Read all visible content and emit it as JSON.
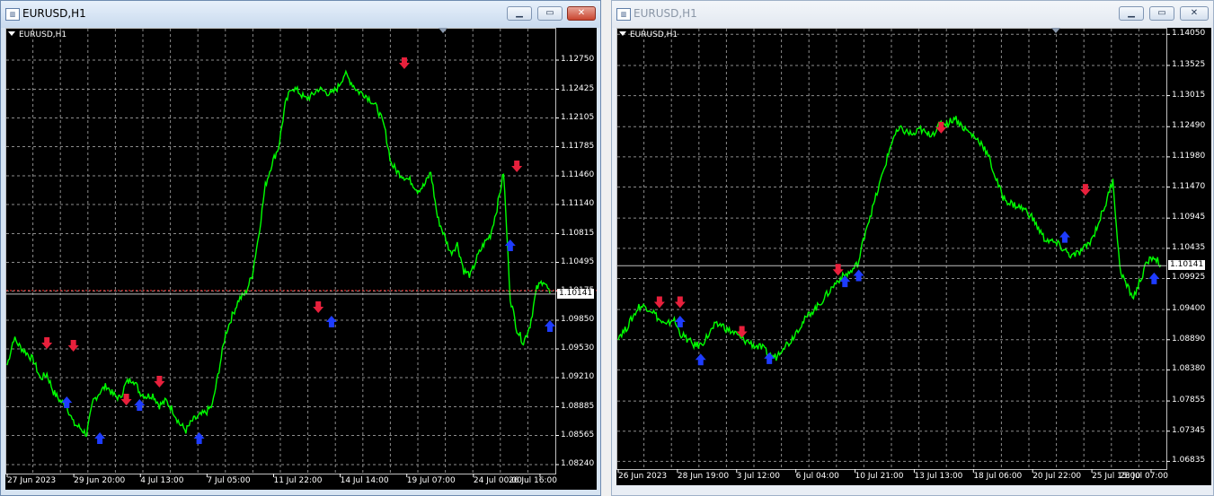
{
  "windows": [
    {
      "title": "EURUSD,H1",
      "chart_label": "EURUSD,H1",
      "current_price": "1.10141",
      "price_ticks": [
        "1.12750",
        "1.12425",
        "1.12105",
        "1.11785",
        "1.11460",
        "1.11140",
        "1.10815",
        "1.10495",
        "1.10175",
        "1.09850",
        "1.09530",
        "1.09210",
        "1.08885",
        "1.08565",
        "1.08240"
      ],
      "time_ticks": [
        "27 Jun 2023",
        "29 Jun 20:00",
        "4 Jul 13:00",
        "7 Jul 05:00",
        "11 Jul 22:00",
        "14 Jul 14:00",
        "19 Jul 07:00",
        "24 Jul 00:00",
        "26 Jul 16:00"
      ]
    },
    {
      "title": "EURUSD,H1",
      "chart_label": "EURUSD,H1",
      "current_price": "1.10141",
      "price_ticks": [
        "1.14050",
        "1.13525",
        "1.13015",
        "1.12490",
        "1.11980",
        "1.11470",
        "1.10945",
        "1.10435",
        "1.09925",
        "1.09400",
        "1.08890",
        "1.08380",
        "1.07855",
        "1.07345",
        "1.06835"
      ],
      "time_ticks": [
        "26 Jun 2023",
        "28 Jun 19:00",
        "3 Jul 12:00",
        "6 Jul 04:00",
        "10 Jul 21:00",
        "13 Jul 13:00",
        "18 Jul 06:00",
        "20 Jul 22:00",
        "25 Jul 15:00",
        "28 Jul 07:00"
      ]
    }
  ],
  "colors": {
    "line": "#00ff00",
    "sell_arrow": "#e8203c",
    "buy_arrow": "#1e3cff",
    "grid": "#8c8c8c",
    "bid_line": "#c0c0c0",
    "alert_line": "#ff3030"
  },
  "icons": {
    "minimize": "minimize-icon",
    "maximize": "maximize-icon",
    "close": "close-icon",
    "window": "chart-window-icon",
    "menu": "triangle-down-icon"
  },
  "chart_data": [
    {
      "type": "line",
      "title": "EURUSD,H1",
      "ylim": [
        1.0824,
        1.1307
      ],
      "xlabel": "",
      "ylabel": "",
      "grid": true,
      "series": [
        {
          "values": [
            1.0935,
            1.0965,
            1.0955,
            1.0948,
            1.094,
            1.092,
            1.0925,
            1.0905,
            1.0895,
            1.089,
            1.087,
            1.0865,
            1.0858,
            1.0895,
            1.0905,
            1.0912,
            1.0902,
            1.0898,
            1.0915,
            1.092,
            1.0905,
            1.09,
            1.0902,
            1.089,
            1.0895,
            1.0885,
            1.087,
            1.0862,
            1.0873,
            1.0878,
            1.0882,
            1.089,
            1.093,
            1.097,
            1.099,
            1.1008,
            1.1015,
            1.1035,
            1.108,
            1.1135,
            1.116,
            1.1178,
            1.1225,
            1.1245,
            1.124,
            1.1232,
            1.1235,
            1.1243,
            1.124,
            1.1237,
            1.1245,
            1.126,
            1.125,
            1.124,
            1.1237,
            1.123,
            1.122,
            1.12,
            1.116,
            1.115,
            1.1145,
            1.114,
            1.113,
            1.1135,
            1.115,
            1.11,
            1.108,
            1.106,
            1.107,
            1.104,
            1.1035,
            1.1055,
            1.107,
            1.108,
            1.111,
            1.115,
            1.101,
            1.0975,
            1.096,
            1.098,
            1.102,
            1.103,
            1.1015
          ]
        }
      ],
      "sell_signals": [
        [
          6,
          1.0958
        ],
        [
          10,
          1.0955
        ],
        [
          18,
          1.0895
        ],
        [
          23,
          1.0915
        ],
        [
          47,
          1.0998
        ],
        [
          60,
          1.127
        ],
        [
          77,
          1.1155
        ]
      ],
      "buy_signals": [
        [
          9,
          1.0895
        ],
        [
          14,
          1.0855
        ],
        [
          20,
          1.0892
        ],
        [
          29,
          1.0855
        ],
        [
          49,
          1.0985
        ],
        [
          76,
          1.107
        ],
        [
          82,
          1.098
        ]
      ]
    },
    {
      "type": "line",
      "title": "EURUSD,H1",
      "ylim": [
        1.0678,
        1.141
      ],
      "xlabel": "",
      "ylabel": "",
      "grid": true,
      "series": [
        {
          "values": [
            1.0895,
            1.0905,
            1.0925,
            1.0945,
            1.0945,
            1.0938,
            1.0922,
            1.0912,
            1.0925,
            1.09,
            1.089,
            1.088,
            1.088,
            1.0895,
            1.0912,
            1.0915,
            1.0905,
            1.09,
            1.089,
            1.0885,
            1.0878,
            1.0875,
            1.0862,
            1.086,
            1.0878,
            1.0885,
            1.0905,
            1.092,
            1.0935,
            1.0945,
            1.096,
            1.0975,
            1.099,
            1.0998,
            1.1005,
            1.102,
            1.1075,
            1.111,
            1.115,
            1.119,
            1.123,
            1.1245,
            1.124,
            1.1235,
            1.1245,
            1.1235,
            1.124,
            1.1255,
            1.1255,
            1.1265,
            1.125,
            1.124,
            1.123,
            1.122,
            1.1195,
            1.116,
            1.113,
            1.112,
            1.1115,
            1.111,
            1.11,
            1.108,
            1.106,
            1.1055,
            1.105,
            1.104,
            1.103,
            1.1035,
            1.1045,
            1.106,
            1.109,
            1.112,
            1.116,
            1.101,
            1.098,
            1.096,
            1.099,
            1.102,
            1.103,
            1.1015
          ]
        }
      ],
      "sell_signals": [
        [
          6,
          1.095
        ],
        [
          9,
          1.095
        ],
        [
          18,
          1.09
        ],
        [
          32,
          1.1005
        ],
        [
          47,
          1.1245
        ],
        [
          68,
          1.114
        ]
      ],
      "buy_signals": [
        [
          9,
          1.0922
        ],
        [
          12,
          1.0858
        ],
        [
          22,
          1.086
        ],
        [
          33,
          1.099
        ],
        [
          35,
          1.1
        ],
        [
          65,
          1.1065
        ],
        [
          78,
          1.0995
        ]
      ]
    }
  ]
}
